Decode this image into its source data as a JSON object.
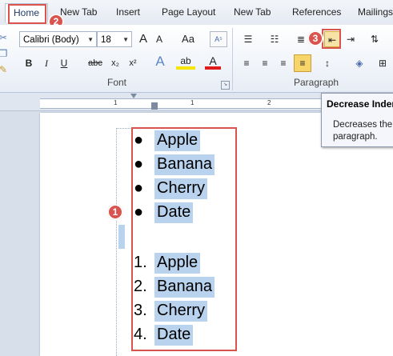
{
  "tabs": [
    "Home",
    "New Tab",
    "Insert",
    "Page Layout",
    "New Tab",
    "References",
    "Mailings"
  ],
  "font": {
    "name": "Calibri (Body)",
    "size": "18",
    "group_label": "Font",
    "buttons": {
      "grow": "A",
      "shrink": "A",
      "case": "Aa",
      "bold": "B",
      "italic": "I",
      "underline": "U",
      "strike": "abc",
      "subscript": "x₂",
      "superscript": "x²",
      "effects": "A",
      "highlight": "ab",
      "color": "A"
    }
  },
  "paragraph": {
    "group_label": "Paragraph"
  },
  "document": {
    "bullets": [
      "Apple",
      "Banana",
      "Cherry",
      "Date"
    ],
    "numbered": [
      {
        "n": "1.",
        "text": "Apple"
      },
      {
        "n": "2.",
        "text": "Banana"
      },
      {
        "n": "3.",
        "text": "Cherry"
      },
      {
        "n": "4.",
        "text": "Date"
      }
    ],
    "bullet_char": "●"
  },
  "ruler": {
    "marks": [
      "1",
      "1",
      "2"
    ]
  },
  "tooltip": {
    "title": "Decrease Indent",
    "body_line1": "Decreases the",
    "body_line2": "paragraph."
  },
  "badges": {
    "list": "1",
    "home": "2",
    "indent": "3"
  },
  "colors": {
    "annotation": "#d9534f",
    "selection": "#b9d3ef"
  }
}
